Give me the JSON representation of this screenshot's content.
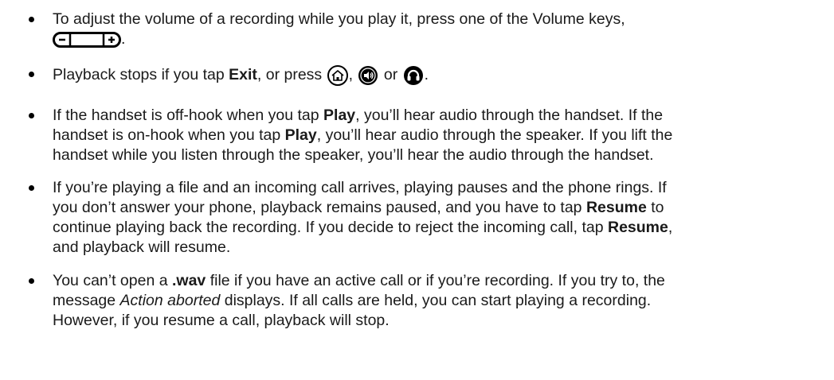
{
  "items": [
    {
      "lines": [
        "To adjust the volume of a recording while you play it, press one of the Volume keys,",
        "."
      ],
      "icons": [
        "volume-keys-icon"
      ]
    },
    {
      "parts": [
        "Playback stops if you tap ",
        "Exit",
        ", or press ",
        ", ",
        " or ",
        "."
      ],
      "icons": [
        "home-key-icon",
        "speaker-key-icon",
        "headset-key-icon"
      ]
    },
    {
      "parts": [
        "If the handset is off-hook when you tap ",
        "Play",
        ", you’ll hear audio through the handset. If the",
        "handset is on-hook when you tap ",
        "Play",
        ", you’ll hear audio through the speaker. If you lift the",
        "handset while you listen through the speaker, you’ll hear the audio through the handset."
      ]
    },
    {
      "parts": [
        "If you’re playing a file and an incoming call arrives, playing pauses and the phone rings. If",
        "you don’t answer your phone, playback remains paused, and you have to tap ",
        "Resume",
        " to",
        "continue playing back the recording. If you decide to reject the incoming call, tap ",
        "Resume",
        ",",
        "and playback will resume."
      ]
    },
    {
      "parts": [
        "You can’t open a ",
        ".wav",
        " file if you have an active call or if you’re recording. If you try to, the",
        "message ",
        "Action aborted",
        " displays. If all calls are held, you can start playing a recording.",
        "However, if you resume a call, playback will stop."
      ]
    }
  ]
}
